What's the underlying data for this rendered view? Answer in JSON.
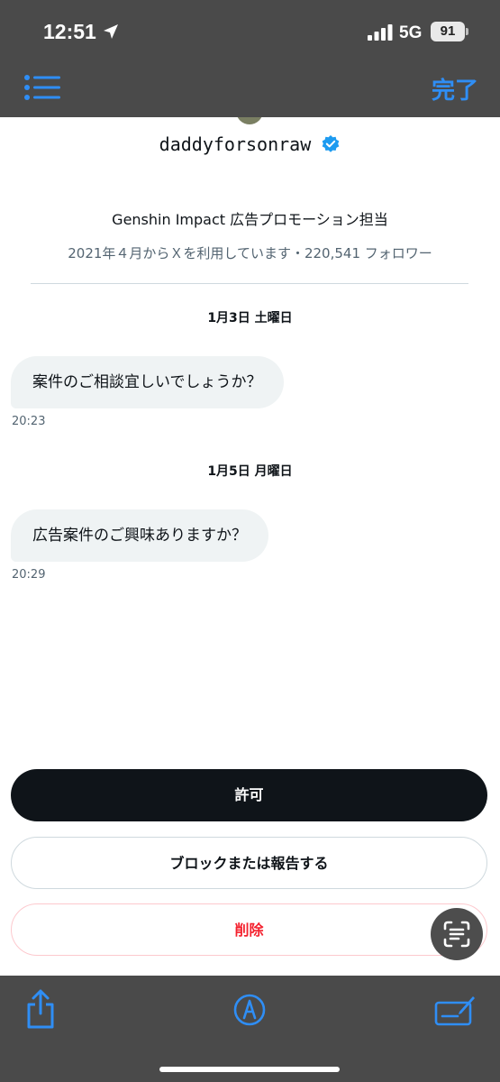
{
  "status_bar": {
    "time": "12:51",
    "network": "5G",
    "battery": "91"
  },
  "toolbar": {
    "menu_icon": "list-icon",
    "done_label": "完了"
  },
  "profile": {
    "username": "daddyforsonraw",
    "verified_icon": "verified-badge-icon",
    "bio": "Genshin Impact 広告プロモーション担当",
    "meta": "2021年４月からＸを利用しています・220,541 フォロワー"
  },
  "messages": [
    {
      "date": "1月3日 土曜日",
      "text": "案件のご相談宜しいでしょうか？",
      "time": "20:23"
    },
    {
      "date": "1月5日 月曜日",
      "text": "広告案件のご興味ありますか？",
      "time": "20:29"
    }
  ],
  "actions": {
    "allow": "許可",
    "block_report": "ブロックまたは報告する",
    "delete": "削除"
  },
  "bottom_toolbar": {
    "icons": [
      "share-icon",
      "markup-icon",
      "annotate-icon"
    ]
  },
  "colors": {
    "accent": "#2f8ef5",
    "verified": "#1d9bf0",
    "delete_red": "#f4212e",
    "allow_bg": "#0f1419"
  }
}
